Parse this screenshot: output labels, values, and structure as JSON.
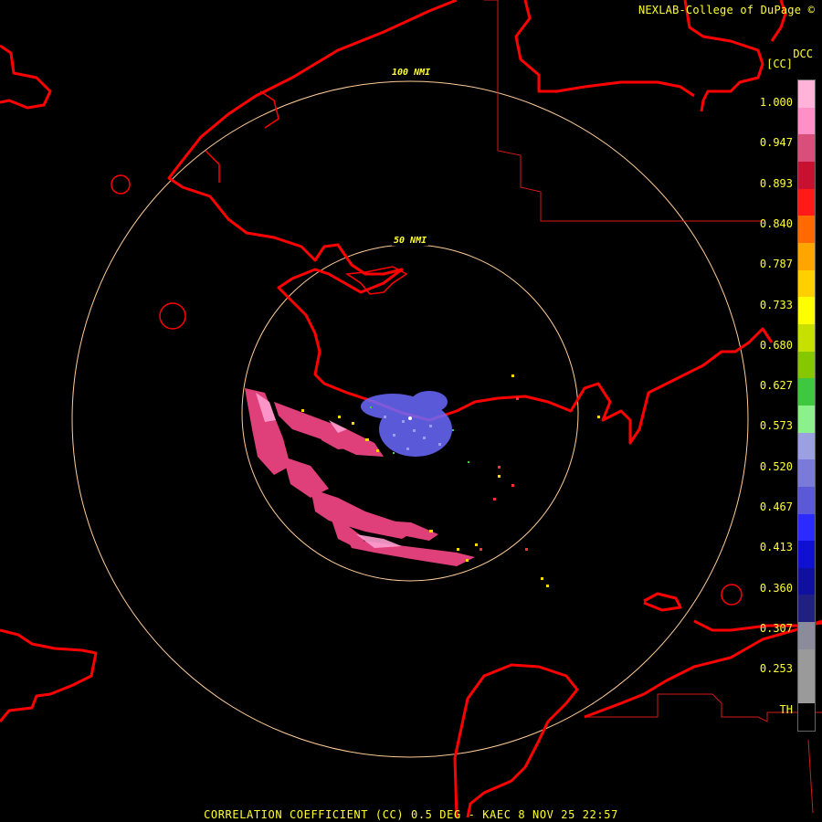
{
  "header": {
    "credit": "NEXLAB-College of DuPage ©"
  },
  "footer": {
    "caption": "CORRELATION COEFFICIENT (CC) 0.5 DEG - KAEC 8 NOV 25 22:57"
  },
  "legend": {
    "product": "DCC",
    "units": "[CC]",
    "ticks": [
      "1.000",
      "0.947",
      "0.893",
      "0.840",
      "0.787",
      "0.733",
      "0.680",
      "0.627",
      "0.573",
      "0.520",
      "0.467",
      "0.413",
      "0.360",
      "0.307",
      "0.253",
      "TH"
    ],
    "colors": [
      "#ffb3d9",
      "#ff8fc6",
      "#d94f7a",
      "#c81030",
      "#ff1a1a",
      "#ff6a00",
      "#ffa500",
      "#ffd000",
      "#ffff00",
      "#c8e000",
      "#86c800",
      "#3fc83f",
      "#8cf08c",
      "#9aa0e0",
      "#7a7ad8",
      "#5a5ad8",
      "#2b2bff",
      "#1010d0",
      "#1010a0",
      "#202080",
      "#8b8b9c",
      "#9a9a9a",
      "#9a9a9a",
      "#000000"
    ]
  },
  "rings": {
    "inner_label": "50 NMI",
    "outer_label": "100 NMI"
  },
  "colors": {
    "coastline": "#ff0000",
    "rings": "#ffcc99",
    "text": "#ffff33"
  }
}
